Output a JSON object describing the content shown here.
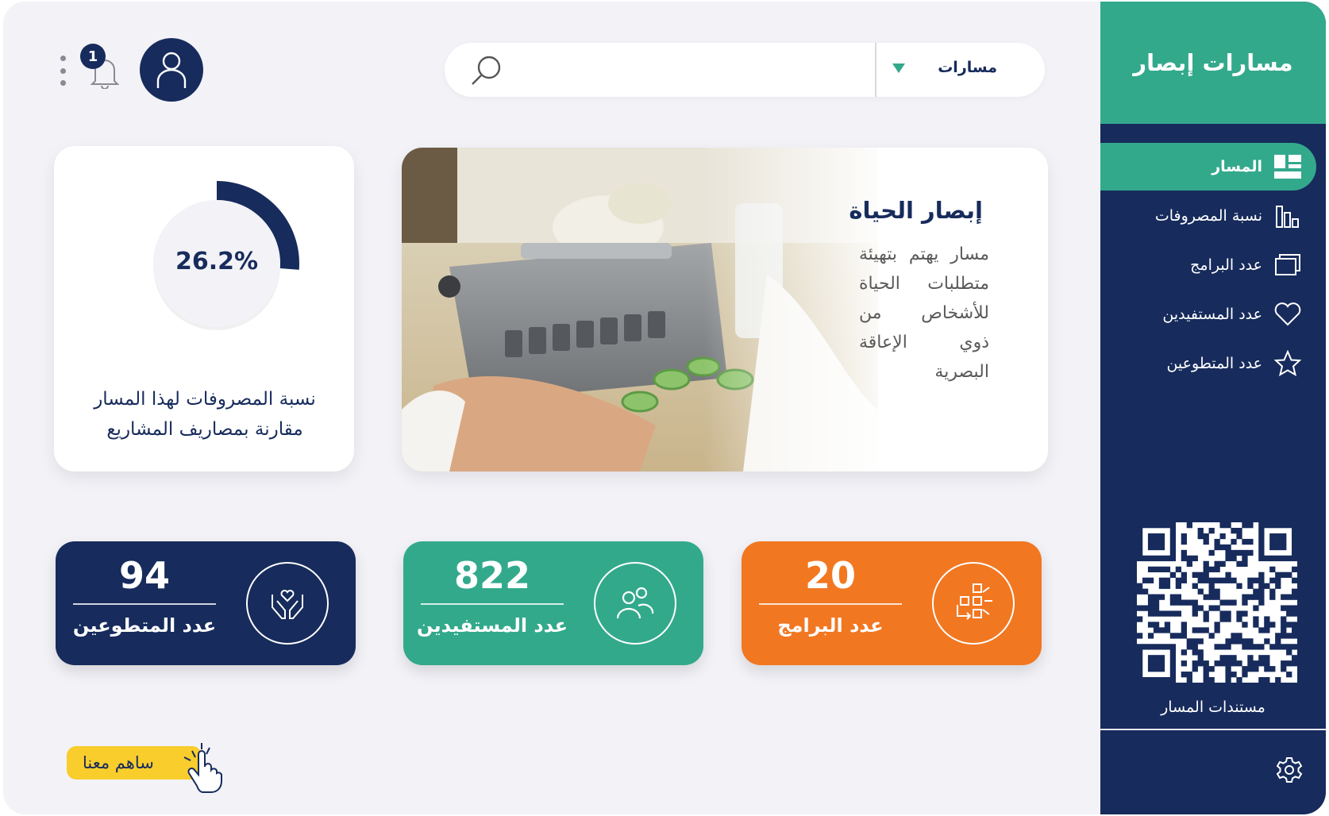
{
  "brand": {
    "title": "مسارات إبصار",
    "accent": "#33a98c",
    "navy": "#172b5c",
    "orange": "#f27721",
    "yellow": "#f8cd2c"
  },
  "sidebar": {
    "items": [
      {
        "label": "المسار",
        "icon": "dashboard-icon",
        "active": true
      },
      {
        "label": "نسبة المصروفات",
        "icon": "bar-chart-icon"
      },
      {
        "label": "عدد البرامج",
        "icon": "screens-icon"
      },
      {
        "label": "عدد المستفيدين",
        "icon": "heart-icon"
      },
      {
        "label": "عدد المتطوعين",
        "icon": "star-icon"
      }
    ],
    "qr_label": "مستندات المسار",
    "settings_icon": "gear-icon"
  },
  "header": {
    "select_value": "مسارات",
    "search_placeholder": "",
    "notification_count": "1"
  },
  "hero": {
    "title": "إبصار الحياة",
    "description": "مسار يهتم بتهيئة متطلبات الحياة للأشخاص من ذوي الإعاقة البصرية"
  },
  "donut": {
    "percent_text": "26.2%",
    "value": 0.262,
    "caption": "نسبة المصروفات لهذا المسار مقارنة بمصاريف المشاريع"
  },
  "stats": [
    {
      "number": "20",
      "label": "عدد البرامج",
      "icon": "programs-icon",
      "color": "#f27721"
    },
    {
      "number": "822",
      "label": "عدد المستفيدين",
      "icon": "people-icon",
      "color": "#33a98c"
    },
    {
      "number": "94",
      "label": "عدد المتطوعين",
      "icon": "hands-heart-icon",
      "color": "#172b5c"
    }
  ],
  "contribute": {
    "label": "ساهم معنا"
  }
}
